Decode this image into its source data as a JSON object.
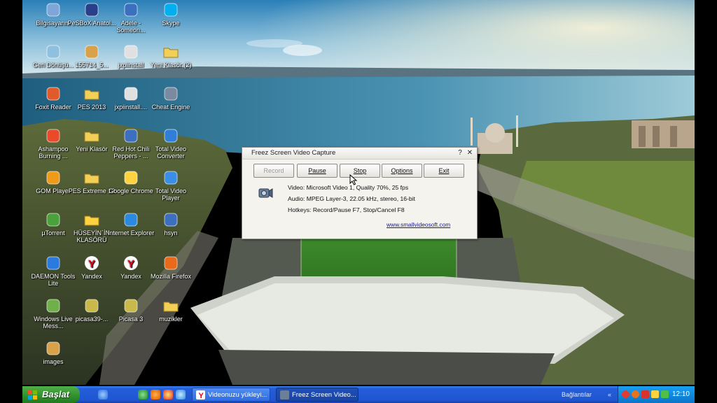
{
  "desktop_icons": [
    {
      "label": "Bilgisayarım",
      "icon": "computer-icon"
    },
    {
      "label": "PeSBoX Anatol...",
      "icon": "pes-icon"
    },
    {
      "label": "Adele - Someon...",
      "icon": "media-file-icon"
    },
    {
      "label": "Skype",
      "icon": "skype-icon"
    },
    {
      "label": "Geri Dönüşü...",
      "icon": "recycle-bin-icon"
    },
    {
      "label": "155714_5...",
      "icon": "archive-icon"
    },
    {
      "label": "jxpiinstall",
      "icon": "java-icon"
    },
    {
      "label": "Yeni Klasör (2)",
      "icon": "folder-icon"
    },
    {
      "label": "Foxit Reader",
      "icon": "foxit-icon"
    },
    {
      "label": "PES 2013",
      "icon": "folder-icon"
    },
    {
      "label": "jxpiinstall....",
      "icon": "java-icon"
    },
    {
      "label": "Cheat Engine",
      "icon": "cheat-engine-icon"
    },
    {
      "label": "Ashampoo Burning ...",
      "icon": "ashampoo-icon"
    },
    {
      "label": "Yeni Klasör",
      "icon": "folder-icon"
    },
    {
      "label": "Red Hot Chili Peppers - ...",
      "icon": "media-file-icon"
    },
    {
      "label": "Total Video Converter",
      "icon": "video-converter-icon"
    },
    {
      "label": "GOM Player",
      "icon": "gom-player-icon"
    },
    {
      "label": "PES Extreme 13",
      "icon": "folder-icon"
    },
    {
      "label": "Google Chrome",
      "icon": "chrome-icon"
    },
    {
      "label": "Total Video Player",
      "icon": "video-player-icon"
    },
    {
      "label": "µTorrent",
      "icon": "utorrent-icon"
    },
    {
      "label": "HÜSEYİN`İN KLASÖRÜ",
      "icon": "star-folder-icon"
    },
    {
      "label": "Internet Explorer",
      "icon": "internet-explorer-icon"
    },
    {
      "label": "hsyn",
      "icon": "media-file-icon"
    },
    {
      "label": "DAEMON Tools Lite",
      "icon": "daemon-tools-icon"
    },
    {
      "label": "Yandex",
      "icon": "yandex-icon"
    },
    {
      "label": "Yandex",
      "icon": "yandex-icon"
    },
    {
      "label": "Mozilla Firefox",
      "icon": "firefox-icon"
    },
    {
      "label": "Windows Live Mess...",
      "icon": "messenger-icon"
    },
    {
      "label": "picasa39-...",
      "icon": "picasa-icon"
    },
    {
      "label": "Picasa 3",
      "icon": "picasa-icon"
    },
    {
      "label": "muzikler",
      "icon": "folder-icon"
    },
    {
      "label": "images",
      "icon": "archive-icon"
    }
  ],
  "window": {
    "title": "Freez Screen Video Capture",
    "help_glyph": "?",
    "close_glyph": "✕",
    "buttons": {
      "record": "Record",
      "pause": "Pause",
      "stop": "Stop",
      "options": "Options",
      "exit": "Exit"
    },
    "video_info": "Video: Microsoft Video 1, Quality 70%, 25 fps",
    "audio_info": "Audio: MPEG Layer-3, 22.05 kHz, stereo, 16-bit",
    "hotkeys_info": "Hotkeys: Record/Pause F7, Stop/Cancel F8",
    "website": "www.smallvideosoft.com"
  },
  "taskbar": {
    "start_label": "Başlat",
    "tasks": [
      {
        "label": "Videonuzu yükleyi...",
        "icon": "yandex-icon",
        "active": false
      },
      {
        "label": "Freez Screen Video...",
        "icon": "video-capture-icon",
        "active": true
      }
    ],
    "connections_label": "Bağlantılar",
    "clock": "12:10"
  },
  "colors": {
    "taskbar_blue": "#245edb",
    "start_green": "#2f8f2b",
    "link_blue": "#1a1a8c"
  }
}
